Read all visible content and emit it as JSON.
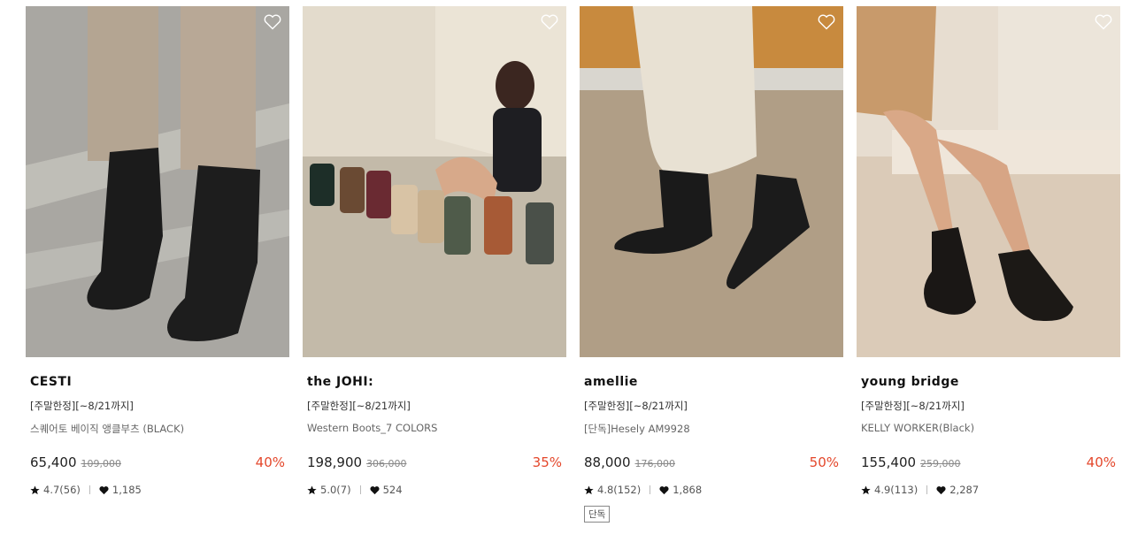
{
  "products": [
    {
      "brand": "CESTI",
      "promo": "[주말한정][~8/21까지]",
      "name": "스퀘어토 베이직 앵클부츠 (BLACK)",
      "price": "65,400",
      "original_price": "109,000",
      "discount": "40%",
      "rating": "4.7(56)",
      "likes": "1,185",
      "tag": ""
    },
    {
      "brand": "the JOHI:",
      "promo": "[주말한정][~8/21까지]",
      "name": "Western Boots_7 COLORS",
      "price": "198,900",
      "original_price": "306,000",
      "discount": "35%",
      "rating": "5.0(7)",
      "likes": "524",
      "tag": ""
    },
    {
      "brand": "amellie",
      "promo": "[주말한정][~8/21까지]",
      "name": "[단독]Hesely AM9928",
      "price": "88,000",
      "original_price": "176,000",
      "discount": "50%",
      "rating": "4.8(152)",
      "likes": "1,868",
      "tag": "단독"
    },
    {
      "brand": "young bridge",
      "promo": "[주말한정][~8/21까지]",
      "name": "KELLY WORKER(Black)",
      "price": "155,400",
      "original_price": "259,000",
      "discount": "40%",
      "rating": "4.9(113)",
      "likes": "2,287",
      "tag": ""
    }
  ],
  "icons": {
    "wishlist": "heart-outline-icon",
    "rating": "star-icon",
    "likes": "heart-filled-icon"
  },
  "colors": {
    "discount": "#e4472b",
    "text": "#111111",
    "muted": "#666666"
  }
}
